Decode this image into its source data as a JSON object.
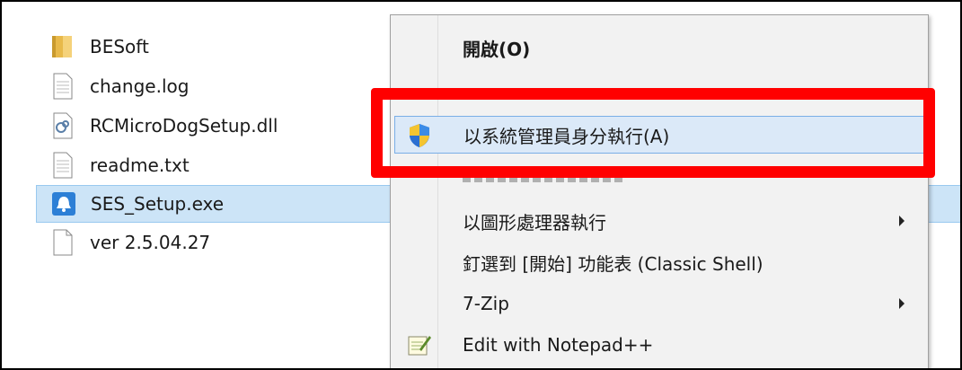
{
  "files": [
    {
      "name": "BESoft",
      "icon": "folder-icon"
    },
    {
      "name": "change.log",
      "icon": "text-file-icon"
    },
    {
      "name": "RCMicroDogSetup.dll",
      "icon": "dll-file-icon"
    },
    {
      "name": "readme.txt",
      "icon": "text-file-icon"
    },
    {
      "name": "SES_Setup.exe",
      "icon": "installer-icon",
      "selected": true
    },
    {
      "name": "ver 2.5.04.27",
      "icon": "blank-file-icon"
    }
  ],
  "context_menu": {
    "open": "開啟(O)",
    "run_as_admin": "以系統管理員身分執行(A)",
    "run_with_gpu": "以圖形處理器執行",
    "pin_start": "釘選到 [開始] 功能表 (Classic Shell)",
    "seven_zip": "7-Zip",
    "edit_notepad": "Edit with Notepad++"
  },
  "colors": {
    "highlight_box": "#ff0000",
    "selection": "#cce4f7",
    "menu_hover": "#dbe9f8"
  }
}
